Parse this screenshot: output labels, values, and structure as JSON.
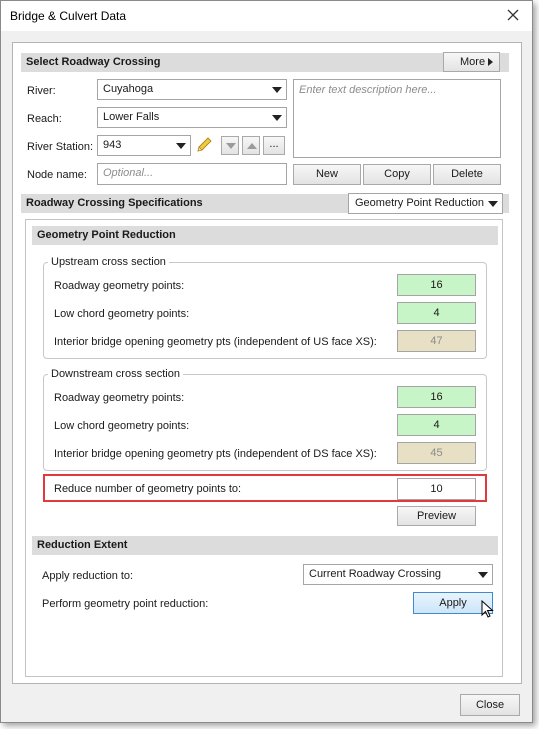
{
  "window": {
    "title": "Bridge & Culvert Data"
  },
  "select_crossing": {
    "header": "Select Roadway Crossing",
    "more_button": "More",
    "river_label": "River:",
    "river_value": "Cuyahoga",
    "reach_label": "Reach:",
    "reach_value": "Lower Falls",
    "station_label": "River Station:",
    "station_value": "943",
    "node_label": "Node name:",
    "node_placeholder": "Optional...",
    "description_placeholder": "Enter text description here...",
    "new_button": "New",
    "copy_button": "Copy",
    "delete_button": "Delete",
    "ellipsis_button": "..."
  },
  "specs": {
    "header": "Roadway Crossing Specifications",
    "dropdown_value": "Geometry Point Reduction"
  },
  "gpr": {
    "header": "Geometry Point Reduction",
    "upstream": {
      "title": "Upstream cross section",
      "rows": [
        {
          "label": "Roadway geometry points:",
          "value": "16"
        },
        {
          "label": "Low chord geometry points:",
          "value": "4"
        },
        {
          "label": "Interior bridge opening geometry pts (independent of US face XS):",
          "value": "47"
        }
      ]
    },
    "downstream": {
      "title": "Downstream cross section",
      "rows": [
        {
          "label": "Roadway geometry points:",
          "value": "16"
        },
        {
          "label": "Low chord geometry points:",
          "value": "4"
        },
        {
          "label": "Interior bridge opening geometry pts (independent of DS face XS):",
          "value": "45"
        }
      ]
    },
    "reduce_label": "Reduce number of geometry points to:",
    "reduce_value": "10",
    "preview_button": "Preview"
  },
  "extent": {
    "header": "Reduction Extent",
    "apply_to_label": "Apply reduction to:",
    "apply_to_value": "Current Roadway Crossing",
    "perform_label": "Perform geometry point reduction:",
    "apply_button": "Apply"
  },
  "footer": {
    "close_button": "Close"
  },
  "colors": {
    "highlight": "#e0393e",
    "computed_box": "#c8f5c8",
    "readonly_box": "#e8e0c4",
    "apply_accent": "#3f8ad0"
  },
  "icons": [
    "close-icon",
    "pencil-icon",
    "down-arrow-icon",
    "up-arrow-icon",
    "dropdown-arrow-icon",
    "play-arrow-icon",
    "mouse-cursor-icon"
  ]
}
